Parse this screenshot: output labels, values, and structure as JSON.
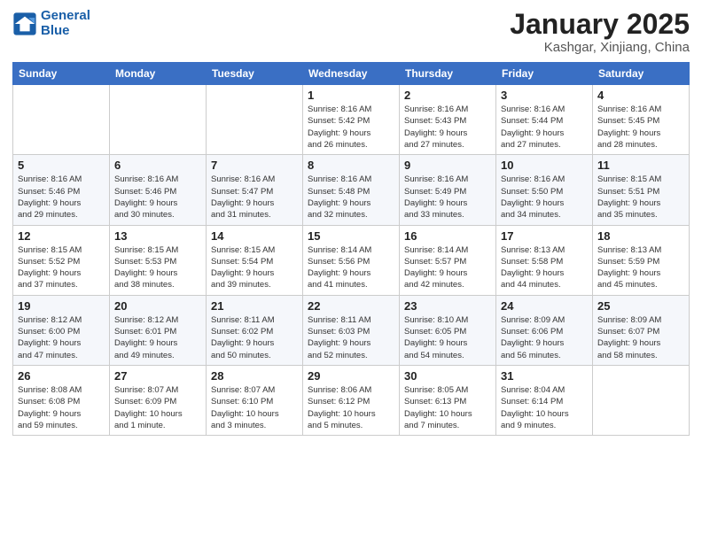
{
  "logo": {
    "line1": "General",
    "line2": "Blue"
  },
  "header": {
    "month": "January 2025",
    "location": "Kashgar, Xinjiang, China"
  },
  "weekdays": [
    "Sunday",
    "Monday",
    "Tuesday",
    "Wednesday",
    "Thursday",
    "Friday",
    "Saturday"
  ],
  "weeks": [
    [
      {
        "day": "",
        "info": ""
      },
      {
        "day": "",
        "info": ""
      },
      {
        "day": "",
        "info": ""
      },
      {
        "day": "1",
        "info": "Sunrise: 8:16 AM\nSunset: 5:42 PM\nDaylight: 9 hours\nand 26 minutes."
      },
      {
        "day": "2",
        "info": "Sunrise: 8:16 AM\nSunset: 5:43 PM\nDaylight: 9 hours\nand 27 minutes."
      },
      {
        "day": "3",
        "info": "Sunrise: 8:16 AM\nSunset: 5:44 PM\nDaylight: 9 hours\nand 27 minutes."
      },
      {
        "day": "4",
        "info": "Sunrise: 8:16 AM\nSunset: 5:45 PM\nDaylight: 9 hours\nand 28 minutes."
      }
    ],
    [
      {
        "day": "5",
        "info": "Sunrise: 8:16 AM\nSunset: 5:46 PM\nDaylight: 9 hours\nand 29 minutes."
      },
      {
        "day": "6",
        "info": "Sunrise: 8:16 AM\nSunset: 5:46 PM\nDaylight: 9 hours\nand 30 minutes."
      },
      {
        "day": "7",
        "info": "Sunrise: 8:16 AM\nSunset: 5:47 PM\nDaylight: 9 hours\nand 31 minutes."
      },
      {
        "day": "8",
        "info": "Sunrise: 8:16 AM\nSunset: 5:48 PM\nDaylight: 9 hours\nand 32 minutes."
      },
      {
        "day": "9",
        "info": "Sunrise: 8:16 AM\nSunset: 5:49 PM\nDaylight: 9 hours\nand 33 minutes."
      },
      {
        "day": "10",
        "info": "Sunrise: 8:16 AM\nSunset: 5:50 PM\nDaylight: 9 hours\nand 34 minutes."
      },
      {
        "day": "11",
        "info": "Sunrise: 8:15 AM\nSunset: 5:51 PM\nDaylight: 9 hours\nand 35 minutes."
      }
    ],
    [
      {
        "day": "12",
        "info": "Sunrise: 8:15 AM\nSunset: 5:52 PM\nDaylight: 9 hours\nand 37 minutes."
      },
      {
        "day": "13",
        "info": "Sunrise: 8:15 AM\nSunset: 5:53 PM\nDaylight: 9 hours\nand 38 minutes."
      },
      {
        "day": "14",
        "info": "Sunrise: 8:15 AM\nSunset: 5:54 PM\nDaylight: 9 hours\nand 39 minutes."
      },
      {
        "day": "15",
        "info": "Sunrise: 8:14 AM\nSunset: 5:56 PM\nDaylight: 9 hours\nand 41 minutes."
      },
      {
        "day": "16",
        "info": "Sunrise: 8:14 AM\nSunset: 5:57 PM\nDaylight: 9 hours\nand 42 minutes."
      },
      {
        "day": "17",
        "info": "Sunrise: 8:13 AM\nSunset: 5:58 PM\nDaylight: 9 hours\nand 44 minutes."
      },
      {
        "day": "18",
        "info": "Sunrise: 8:13 AM\nSunset: 5:59 PM\nDaylight: 9 hours\nand 45 minutes."
      }
    ],
    [
      {
        "day": "19",
        "info": "Sunrise: 8:12 AM\nSunset: 6:00 PM\nDaylight: 9 hours\nand 47 minutes."
      },
      {
        "day": "20",
        "info": "Sunrise: 8:12 AM\nSunset: 6:01 PM\nDaylight: 9 hours\nand 49 minutes."
      },
      {
        "day": "21",
        "info": "Sunrise: 8:11 AM\nSunset: 6:02 PM\nDaylight: 9 hours\nand 50 minutes."
      },
      {
        "day": "22",
        "info": "Sunrise: 8:11 AM\nSunset: 6:03 PM\nDaylight: 9 hours\nand 52 minutes."
      },
      {
        "day": "23",
        "info": "Sunrise: 8:10 AM\nSunset: 6:05 PM\nDaylight: 9 hours\nand 54 minutes."
      },
      {
        "day": "24",
        "info": "Sunrise: 8:09 AM\nSunset: 6:06 PM\nDaylight: 9 hours\nand 56 minutes."
      },
      {
        "day": "25",
        "info": "Sunrise: 8:09 AM\nSunset: 6:07 PM\nDaylight: 9 hours\nand 58 minutes."
      }
    ],
    [
      {
        "day": "26",
        "info": "Sunrise: 8:08 AM\nSunset: 6:08 PM\nDaylight: 9 hours\nand 59 minutes."
      },
      {
        "day": "27",
        "info": "Sunrise: 8:07 AM\nSunset: 6:09 PM\nDaylight: 10 hours\nand 1 minute."
      },
      {
        "day": "28",
        "info": "Sunrise: 8:07 AM\nSunset: 6:10 PM\nDaylight: 10 hours\nand 3 minutes."
      },
      {
        "day": "29",
        "info": "Sunrise: 8:06 AM\nSunset: 6:12 PM\nDaylight: 10 hours\nand 5 minutes."
      },
      {
        "day": "30",
        "info": "Sunrise: 8:05 AM\nSunset: 6:13 PM\nDaylight: 10 hours\nand 7 minutes."
      },
      {
        "day": "31",
        "info": "Sunrise: 8:04 AM\nSunset: 6:14 PM\nDaylight: 10 hours\nand 9 minutes."
      },
      {
        "day": "",
        "info": ""
      }
    ]
  ]
}
